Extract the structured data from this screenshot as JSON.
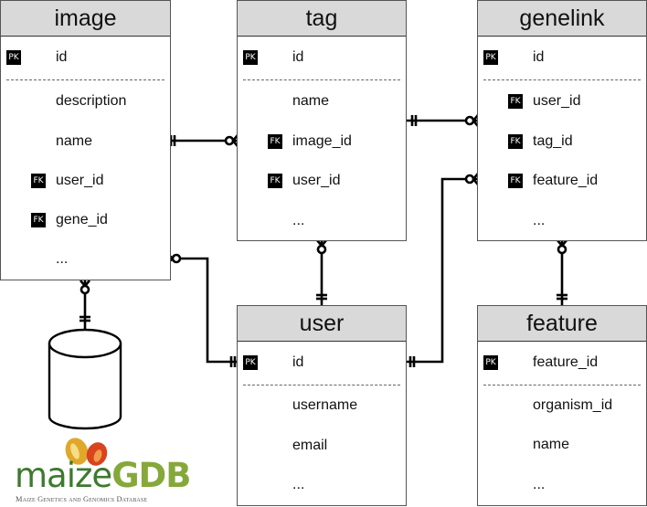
{
  "diagram": {
    "type": "entity-relationship",
    "badges": {
      "primary_key": "PK",
      "foreign_key": "FK"
    },
    "entities": {
      "image": {
        "title": "image",
        "pk": {
          "badge": "PK",
          "name": "id"
        },
        "fields": [
          {
            "name": "description",
            "badge": ""
          },
          {
            "name": "name",
            "badge": ""
          },
          {
            "name": "user_id",
            "badge": "FK"
          },
          {
            "name": "gene_id",
            "badge": "FK"
          },
          {
            "name": "...",
            "badge": ""
          }
        ]
      },
      "tag": {
        "title": "tag",
        "pk": {
          "badge": "PK",
          "name": "id"
        },
        "fields": [
          {
            "name": "name",
            "badge": ""
          },
          {
            "name": "image_id",
            "badge": "FK"
          },
          {
            "name": "user_id",
            "badge": "FK"
          },
          {
            "name": "...",
            "badge": ""
          }
        ]
      },
      "genelink": {
        "title": "genelink",
        "pk": {
          "badge": "PK",
          "name": "id"
        },
        "fields": [
          {
            "name": "user_id",
            "badge": "FK"
          },
          {
            "name": "tag_id",
            "badge": "FK"
          },
          {
            "name": "feature_id",
            "badge": "FK"
          },
          {
            "name": "...",
            "badge": ""
          }
        ]
      },
      "user": {
        "title": "user",
        "pk": {
          "badge": "PK",
          "name": "id"
        },
        "fields": [
          {
            "name": "username",
            "badge": ""
          },
          {
            "name": "email",
            "badge": ""
          },
          {
            "name": "...",
            "badge": ""
          }
        ]
      },
      "feature": {
        "title": "feature",
        "pk": {
          "badge": "PK",
          "name": "feature_id"
        },
        "fields": [
          {
            "name": "organism_id",
            "badge": ""
          },
          {
            "name": "name",
            "badge": ""
          },
          {
            "name": "...",
            "badge": ""
          }
        ]
      }
    },
    "relationships": [
      {
        "from": "image.name",
        "from_cardinality": "one-and-only-one",
        "to": "tag.image_id",
        "to_cardinality": "zero-or-many"
      },
      {
        "from": "tag",
        "from_cardinality": "one-and-only-one",
        "to": "genelink.user_id",
        "to_cardinality": "zero-or-many"
      },
      {
        "from": "user.id",
        "from_cardinality": "one-and-only-one",
        "to": "genelink.feature_id",
        "to_cardinality": "zero-or-many"
      },
      {
        "from": "user.id",
        "from_cardinality": "one-and-only-one",
        "to": "image",
        "to_cardinality": "zero-or-many"
      },
      {
        "from": "user",
        "from_cardinality": "one-and-only-one",
        "to": "tag",
        "to_cardinality": "zero-or-many"
      },
      {
        "from": "feature",
        "from_cardinality": "one-and-only-one",
        "to": "genelink",
        "to_cardinality": "zero-or-many"
      },
      {
        "from": "image-storage",
        "from_cardinality": "one-and-only-one",
        "to": "image",
        "to_cardinality": "zero-or-many"
      }
    ],
    "storage": {
      "icon": "database-cylinder-icon"
    },
    "logo": {
      "word_left": "maize",
      "word_right": "GDB",
      "subtitle": "Maize Genetics and Genomics Database",
      "colors": {
        "left": "#3d7a2e",
        "right": "#86a83a",
        "kernel_yellow": "#e0a82a",
        "kernel_red": "#d9431e"
      }
    }
  }
}
